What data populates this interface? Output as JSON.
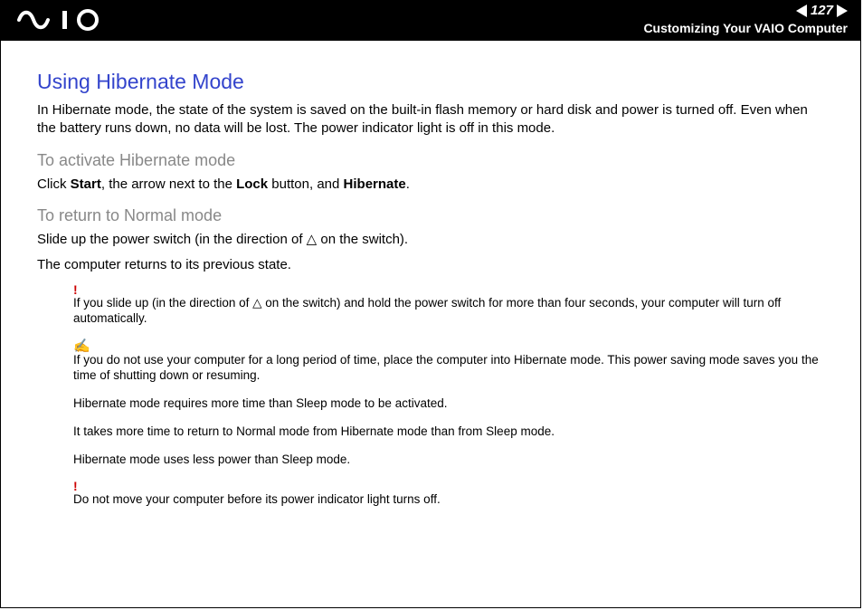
{
  "header": {
    "page_number": "127",
    "breadcrumb": "Customizing Your VAIO Computer"
  },
  "body": {
    "title": "Using Hibernate Mode",
    "intro": "In Hibernate mode, the state of the system is saved on the built-in flash memory or hard disk and power is turned off. Even when the battery runs down, no data will be lost. The power indicator light is off in this mode.",
    "sec1_title": "To activate Hibernate mode",
    "sec1_p_pre": "Click ",
    "sec1_b1": "Start",
    "sec1_p_mid1": ", the arrow next to the ",
    "sec1_b2": "Lock",
    "sec1_p_mid2": " button, and ",
    "sec1_b3": "Hibernate",
    "sec1_p_end": ".",
    "sec2_title": "To return to Normal mode",
    "sec2_p1": "Slide up the power switch (in the direction of △ on the switch).",
    "sec2_p2": "The computer returns to its previous state.",
    "warn1_mark": "!",
    "warn1_text": "If you slide up (in the direction of △ on the switch) and hold the power switch for more than four seconds, your computer will turn off automatically.",
    "tip_mark": "✍",
    "tip1_text": "If you do not use your computer for a long period of time, place the computer into Hibernate mode. This power saving mode saves you the time of shutting down or resuming.",
    "tip2_text": "Hibernate mode requires more time than Sleep mode to be activated.",
    "tip3_text": "It takes more time to return to Normal mode from Hibernate mode than from Sleep mode.",
    "tip4_text": "Hibernate mode uses less power than Sleep mode.",
    "warn2_mark": "!",
    "warn2_text": "Do not move your computer before its power indicator light turns off."
  }
}
